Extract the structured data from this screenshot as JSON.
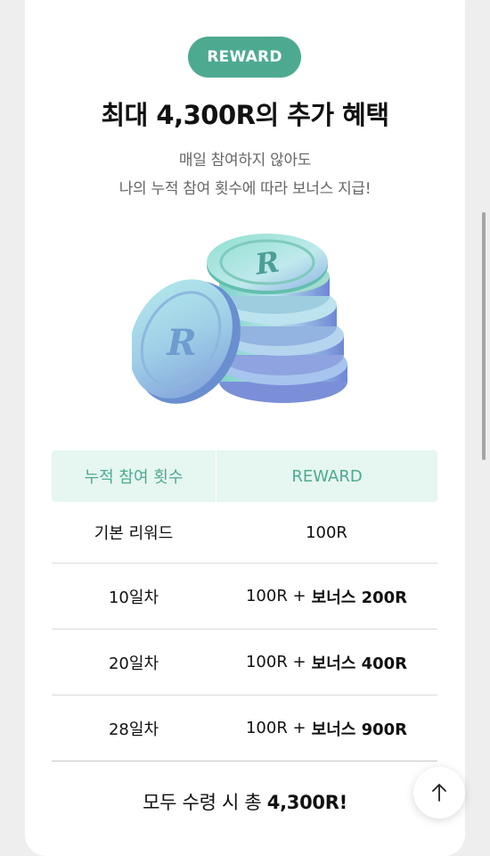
{
  "colors": {
    "accent": "#4daa91",
    "header_bg": "#e6f6f0"
  },
  "badge": "REWARD",
  "title": "최대 4,300R의 추가 혜택",
  "subtitle_lines": [
    "매일 참여하지 않아도",
    "나의 누적 참여 횟수에 따라 보너스 지급!"
  ],
  "coin_icon": "coin-stack-icon",
  "coin_letter": "R",
  "table": {
    "headers": [
      "누적 참여 횟수",
      "REWARD"
    ],
    "rows": [
      {
        "count": "기본 리워드",
        "reward": "100R",
        "bonus": ""
      },
      {
        "count": "10일차",
        "reward": "100R +",
        "bonus": "보너스 200R"
      },
      {
        "count": "20일차",
        "reward": "100R +",
        "bonus": "보너스 400R"
      },
      {
        "count": "28일차",
        "reward": "100R +",
        "bonus": "보너스 900R"
      }
    ]
  },
  "total": {
    "prefix": "모두 수령 시 총",
    "amount": "4,300R!"
  },
  "scroll_top_icon": "arrow-up-icon"
}
